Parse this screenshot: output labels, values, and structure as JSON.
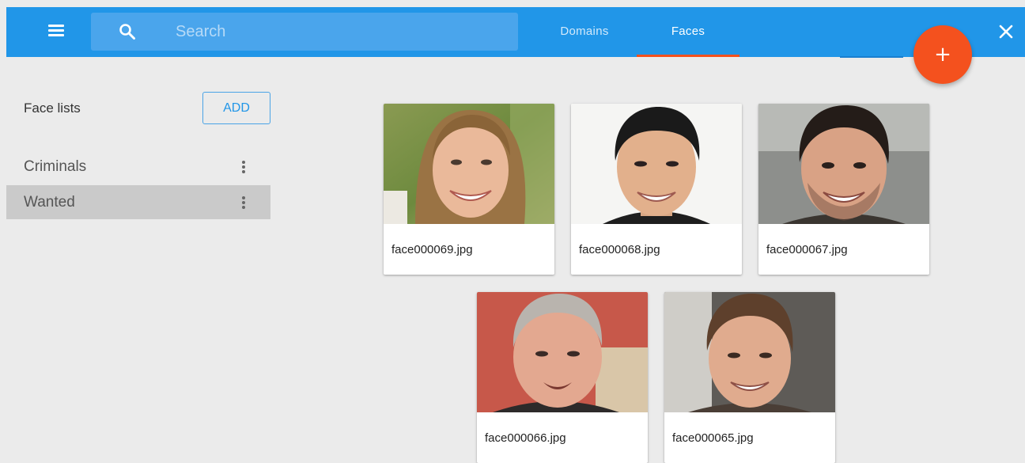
{
  "topbar": {
    "search_placeholder": "Search",
    "tabs": [
      {
        "label": "Domains",
        "active": false
      },
      {
        "label": "Faces",
        "active": true
      }
    ],
    "fab_label": "+",
    "accent_color": "#2196e8",
    "fab_color": "#f4511e"
  },
  "sidebar": {
    "title": "Face lists",
    "add_label": "ADD",
    "lists": [
      {
        "label": "Criminals",
        "selected": false
      },
      {
        "label": "Wanted",
        "selected": true
      }
    ]
  },
  "faces": [
    {
      "filename": "face000069.jpg"
    },
    {
      "filename": "face000068.jpg"
    },
    {
      "filename": "face000067.jpg"
    },
    {
      "filename": "face000066.jpg"
    },
    {
      "filename": "face000065.jpg"
    }
  ]
}
